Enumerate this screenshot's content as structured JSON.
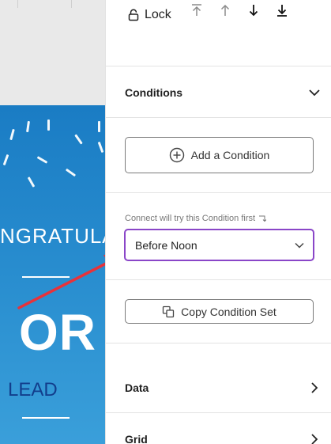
{
  "canvas": {
    "headline_fragment": "NGRATULA",
    "big_word_fragment": "OR",
    "subtitle_fragment": "LEAD"
  },
  "toolbar": {
    "lock_label": "Lock",
    "order_buttons": [
      "bring-to-front",
      "bring-forward",
      "send-backward",
      "send-to-back"
    ]
  },
  "conditions": {
    "title": "Conditions",
    "add_label": "Add a Condition",
    "hint": "Connect will try this Condition first",
    "selected": "Before Noon",
    "copy_label": "Copy Condition Set"
  },
  "sections": {
    "data_title": "Data",
    "grid_title": "Grid"
  },
  "colors": {
    "preview_blue": "#1a7cc4",
    "select_focus": "#8a46c8",
    "annotation_arrow": "#e8323a",
    "lead_text": "#123e8c"
  }
}
